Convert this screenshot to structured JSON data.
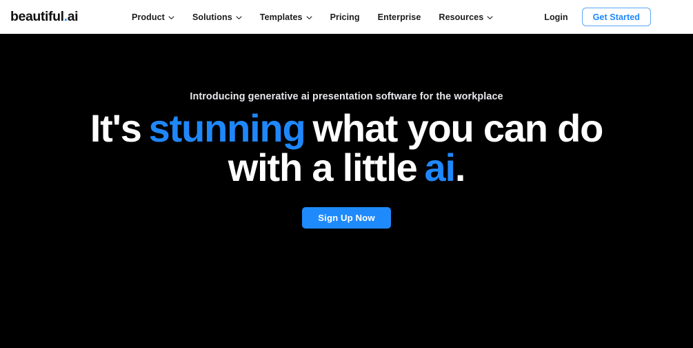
{
  "navbar": {
    "logo": {
      "name_primary": "beautiful",
      "dot": ".",
      "name_secondary": "ai"
    },
    "links": [
      {
        "label": "Product",
        "has_dropdown": true,
        "icon": "chevron-down-icon"
      },
      {
        "label": "Solutions",
        "has_dropdown": true,
        "icon": "chevron-down-icon"
      },
      {
        "label": "Templates",
        "has_dropdown": true,
        "icon": "chevron-down-icon"
      },
      {
        "label": "Pricing",
        "has_dropdown": false,
        "icon": ""
      },
      {
        "label": "Enterprise",
        "has_dropdown": false,
        "icon": ""
      },
      {
        "label": "Resources",
        "has_dropdown": true,
        "icon": "chevron-down-icon"
      }
    ],
    "login_label": "Login",
    "get_started_label": "Get Started"
  },
  "hero": {
    "eyebrow": "Introducing generative ai presentation software for the workplace",
    "headline": {
      "line1_part1": "It's",
      "line1_accent": "stunning",
      "line1_part2": "what you can do",
      "line2_part1": "with a little",
      "line2_accent": "ai",
      "line2_part2": "."
    },
    "cta_label": "Sign Up Now"
  },
  "colors": {
    "brand_blue": "#1f87fa",
    "cta_blue": "#1f8afc",
    "hero_background": "#000000",
    "navbar_background": "#ffffff",
    "nav_text": "#1c1c1c",
    "eyebrow_text": "#e9e9ee",
    "headline_text": "#ffffff",
    "get_started_border": "#58a6f5"
  }
}
